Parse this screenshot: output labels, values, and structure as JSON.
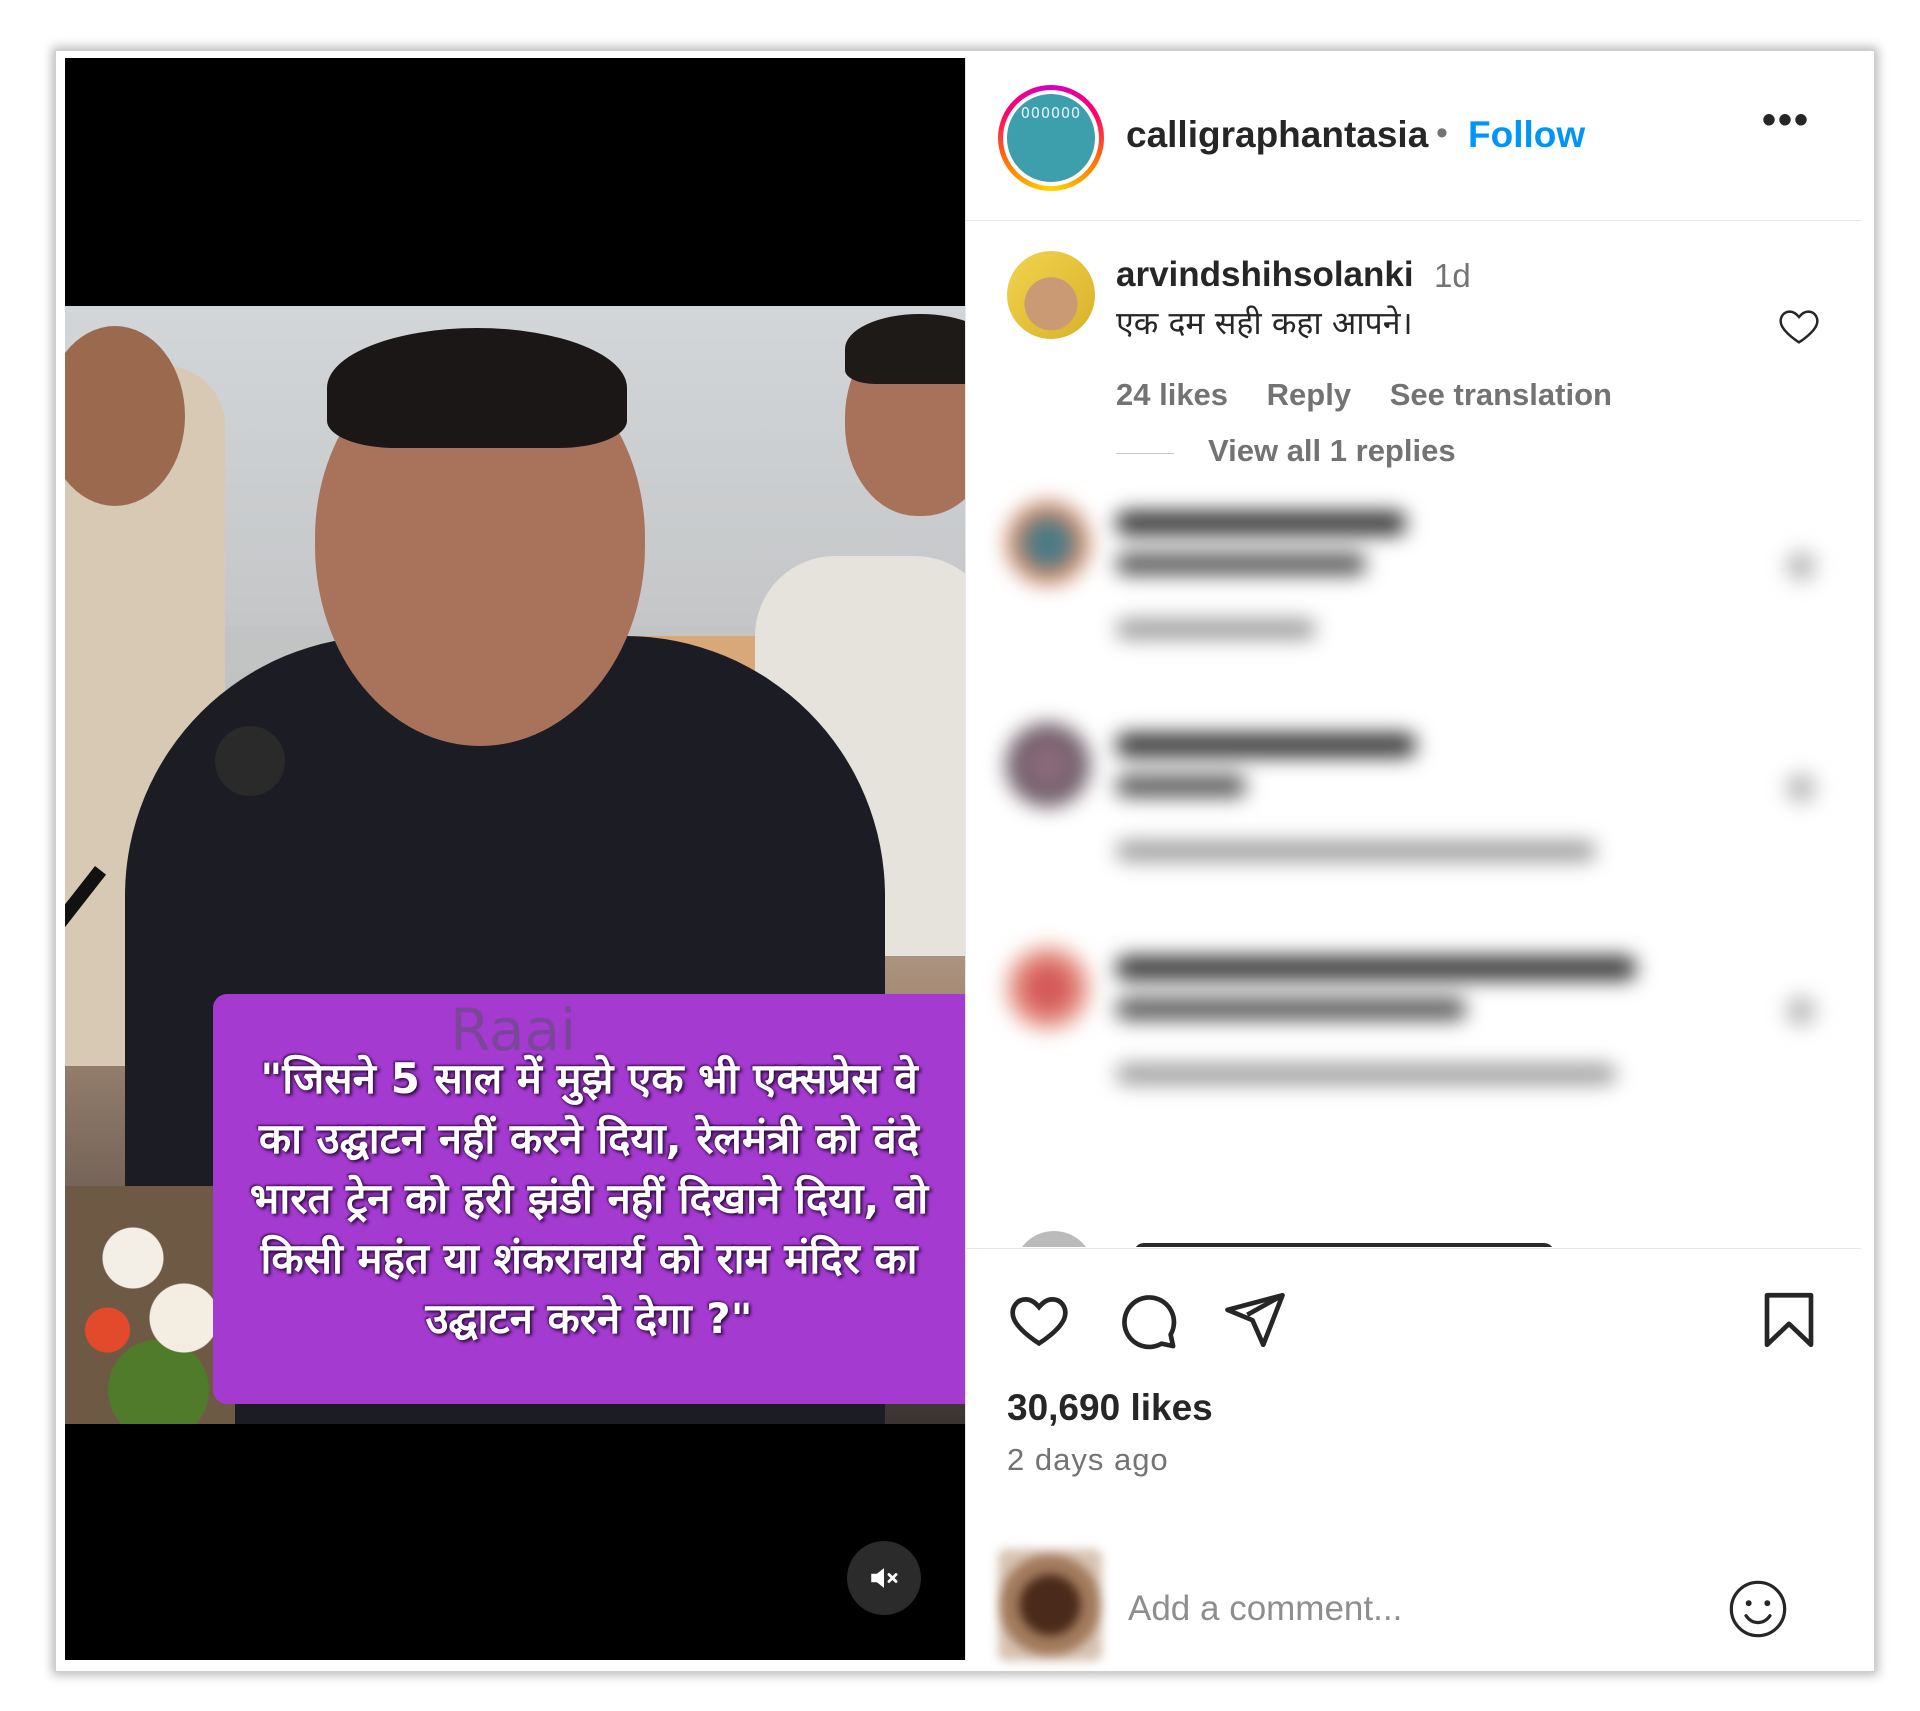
{
  "post": {
    "author": "calligraphantasia",
    "separator": "•",
    "follow_label": "Follow",
    "more_label": "•••",
    "avatar_text": "OOOOOO",
    "watermark": "Raai",
    "quote": "\"जिसने 5 साल में मुझे एक भी एक्सप्रेस वे का उद्घाटन नहीं करने दिया, रेलमंत्री को वंदे भारत ट्रेन को हरी झंडी नहीं दिखाने दिया, वो किसी महंत या शंकराचार्य को राम मंदिर का उद्घाटन करने देगा ?\""
  },
  "comment": {
    "username": "arvindshihsolanki",
    "time": "1d",
    "text": "एक दम सही कहा आपने।",
    "likes": "24 likes",
    "reply_label": "Reply",
    "translate_label": "See translation",
    "view_replies": "View all 1 replies"
  },
  "stats": {
    "likes": "30,690 likes",
    "posted": "2 days ago"
  },
  "composer": {
    "placeholder": "Add a comment..."
  },
  "icons": {
    "like": "heart-icon",
    "comment": "comment-bubble-icon",
    "share": "paper-plane-icon",
    "save": "bookmark-icon",
    "emoji": "smiley-icon",
    "mute": "speaker-muted-icon"
  },
  "colors": {
    "accent": "#0095f6",
    "quote_bg": "#a43ad0",
    "text": "#262626",
    "muted": "#737373"
  }
}
